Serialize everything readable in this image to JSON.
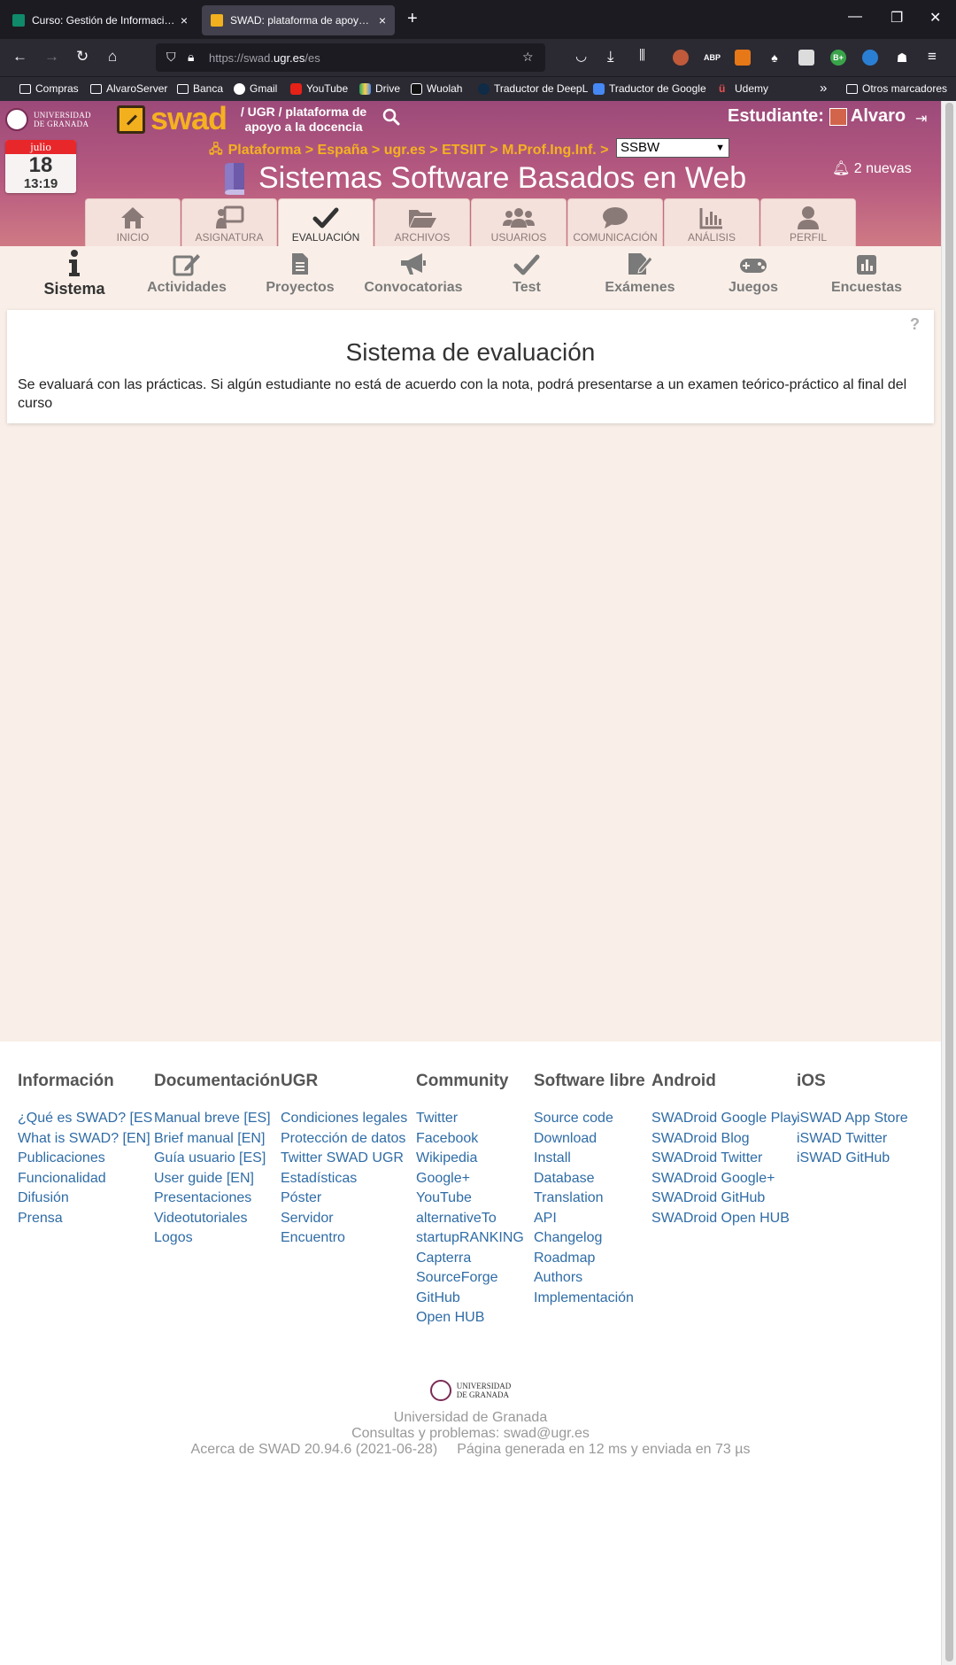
{
  "browser": {
    "tabs": [
      {
        "title": "Curso: Gestión de Información"
      },
      {
        "title": "SWAD: plataforma de apoyo a la"
      }
    ],
    "url_prefix": "https://swad.",
    "url_domain": "ugr.es",
    "url_path": "/es",
    "bookmarks": [
      "Compras",
      "AlvaroServer",
      "Banca",
      "Gmail",
      "YouTube",
      "Drive",
      "Wuolah",
      "Traductor de DeepL",
      "Traductor de Google",
      "Udemy",
      "Otros marcadores"
    ],
    "extensions": [
      {
        "label": "ABP",
        "color": "#e3262f"
      },
      {
        "label": "B+",
        "color": "#3aa34a"
      }
    ]
  },
  "header": {
    "university_line1": "UNIVERSIDAD",
    "university_line2": "DE GRANADA",
    "swad_word": "swad",
    "tagline": "/ UGR / plataforma de apoyo a la docencia",
    "role_label": "Estudiante:",
    "user_name": "Alvaro",
    "calendar": {
      "month": "julio",
      "day": "18",
      "time": "13:19"
    },
    "breadcrumb": "Plataforma > España > ugr.es > ETSIIT > M.Prof.Ing.Inf. >",
    "course_select_value": "SSBW",
    "course_title": "Sistemas Software Basados en Web",
    "notifications": "2 nuevas"
  },
  "main_menu": [
    {
      "label": "INICIO",
      "icon": "home-icon"
    },
    {
      "label": "ASIGNATURA",
      "icon": "course-icon"
    },
    {
      "label": "EVALUACIÓN",
      "icon": "check-icon",
      "active": true
    },
    {
      "label": "ARCHIVOS",
      "icon": "folder-icon"
    },
    {
      "label": "USUARIOS",
      "icon": "users-icon"
    },
    {
      "label": "COMUNICACIÓN",
      "icon": "chat-icon"
    },
    {
      "label": "ANÁLISIS",
      "icon": "chart-icon"
    },
    {
      "label": "PERFIL",
      "icon": "user-icon"
    }
  ],
  "sub_menu": [
    {
      "label": "Sistema",
      "icon": "info-icon",
      "active": true
    },
    {
      "label": "Actividades",
      "icon": "edit-icon"
    },
    {
      "label": "Proyectos",
      "icon": "document-icon"
    },
    {
      "label": "Convocatorias",
      "icon": "megaphone-icon"
    },
    {
      "label": "Test",
      "icon": "check-icon"
    },
    {
      "label": "Exámenes",
      "icon": "exam-icon"
    },
    {
      "label": "Juegos",
      "icon": "gamepad-icon"
    },
    {
      "label": "Encuestas",
      "icon": "poll-icon"
    }
  ],
  "content": {
    "title": "Sistema de evaluación",
    "text": "Se evaluará con las prácticas. Si algún estudiante no está de acuerdo con la nota, podrá presentarse a un examen teórico-práctico al final del curso",
    "help": "?"
  },
  "footer": {
    "columns": [
      {
        "heading": "Información",
        "links": [
          "¿Qué es SWAD? [ES]",
          "What is SWAD? [EN]",
          "Publicaciones",
          "Funcionalidad",
          "Difusión",
          "Prensa"
        ]
      },
      {
        "heading": "Documentación",
        "links": [
          "Manual breve [ES]",
          "Brief manual [EN]",
          "Guía usuario [ES]",
          "User guide [EN]",
          "Presentaciones",
          "Videotutoriales",
          "Logos"
        ]
      },
      {
        "heading": "UGR",
        "links": [
          "Condiciones legales",
          "Protección de datos",
          "Twitter SWAD UGR",
          "Estadísticas",
          "Póster",
          "Servidor",
          "Encuentro"
        ]
      },
      {
        "heading": "Community",
        "links": [
          "Twitter",
          "Facebook",
          "Wikipedia",
          "Google+",
          "YouTube",
          "alternativeTo",
          "startupRANKING",
          "Capterra",
          "SourceForge",
          "GitHub",
          "Open HUB"
        ]
      },
      {
        "heading": "Software libre",
        "links": [
          "Source code",
          "Download",
          "Install",
          "Database",
          "Translation",
          "API",
          "Changelog",
          "Roadmap",
          "Authors",
          "Implementación"
        ]
      },
      {
        "heading": "Android",
        "links": [
          "SWADroid Google Play",
          "SWADroid Blog",
          "SWADroid Twitter",
          "SWADroid Google+",
          "SWADroid GitHub",
          "SWADroid Open HUB"
        ]
      },
      {
        "heading": "iOS",
        "links": [
          "iSWAD App Store",
          "iSWAD Twitter",
          "iSWAD GitHub"
        ]
      }
    ],
    "university": "Universidad de Granada",
    "contact": "Consultas y problemas: swad@ugr.es",
    "about": "Acerca de SWAD 20.94.6 (2021-06-28)",
    "generated": "Página generada en 12 ms y enviada en 73 µs"
  },
  "colors": {
    "header_gradient_top": "#9c4a7a",
    "accent_orange": "#f5b120",
    "link_blue": "#2f6ca6",
    "page_bg": "#f9efe8"
  }
}
